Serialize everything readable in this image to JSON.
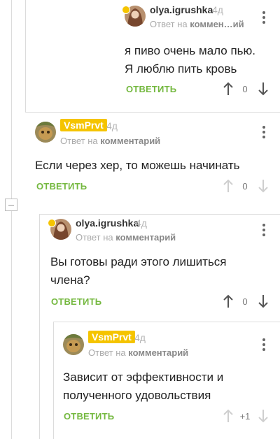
{
  "colors": {
    "accent_green": "#74b83f",
    "badge_yellow": "#f5c400",
    "muted_text": "#aaaaaa",
    "thread_line": "#dcdcdc"
  },
  "icons": {
    "upvote": "arrow-up-icon",
    "downvote": "arrow-down-icon",
    "menu": "vertical-dots-icon",
    "collapse": "minus-box-icon"
  },
  "comments": [
    {
      "author": "olya.igrushka",
      "time": "4д",
      "meta_prefix": "Ответ на",
      "meta_target": "коммен…ий",
      "text_lines": [
        "я пиво очень мало пью.",
        "Я люблю пить кровь"
      ],
      "reply_label": "ОТВЕТИТЬ",
      "score": "0"
    },
    {
      "author": "VsmPrvt",
      "time": "4д",
      "meta_prefix": "Ответ на",
      "meta_target": "комментарий",
      "text_lines": [
        "Если через хер, то можешь начинать"
      ],
      "reply_label": "ОТВЕТИТЬ",
      "score": "0"
    },
    {
      "author": "olya.igrushka",
      "time": "4д",
      "meta_prefix": "Ответ на",
      "meta_target": "комментарий",
      "text_lines": [
        "Вы готовы ради этого лишиться",
        "члена?"
      ],
      "reply_label": "ОТВЕТИТЬ",
      "score": "0"
    },
    {
      "author": "VsmPrvt",
      "time": "4д",
      "meta_prefix": "Ответ на",
      "meta_target": "комментарий",
      "text_lines": [
        "Зависит от эффективности и",
        "полученного удовольствия"
      ],
      "reply_label": "ОТВЕТИТЬ",
      "score": "+1"
    }
  ]
}
